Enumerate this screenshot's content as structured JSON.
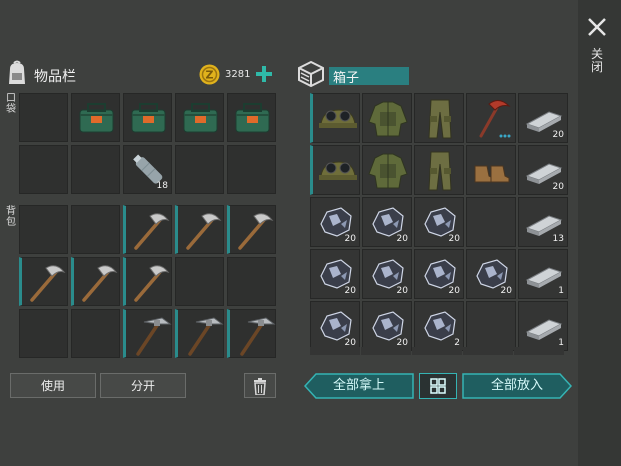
{
  "inventory": {
    "title": "物品栏",
    "coins": "3281",
    "pocket_label": "口袋",
    "backpack_label": "背包",
    "use_label": "使用",
    "split_label": "分开"
  },
  "box": {
    "title": "箱子",
    "take_all_label": "全部拿上",
    "put_all_label": "全部放入"
  },
  "close_label": "关闭",
  "pocket_slots": [
    {
      "item": "",
      "count": ""
    },
    {
      "item": "toolbox-icon",
      "count": ""
    },
    {
      "item": "toolbox-icon",
      "count": ""
    },
    {
      "item": "toolbox-icon",
      "count": ""
    },
    {
      "item": "toolbox-icon",
      "count": ""
    },
    {
      "item": "",
      "count": ""
    },
    {
      "item": "",
      "count": ""
    },
    {
      "item": "water-bottle-icon",
      "count": "18"
    },
    {
      "item": "",
      "count": ""
    },
    {
      "item": "",
      "count": ""
    }
  ],
  "backpack_slots": [
    {
      "item": "",
      "count": ""
    },
    {
      "item": "",
      "count": ""
    },
    {
      "item": "stone-pickaxe-icon",
      "count": ""
    },
    {
      "item": "stone-pickaxe-icon",
      "count": ""
    },
    {
      "item": "stone-pickaxe-icon",
      "count": ""
    },
    {
      "item": "stone-pickaxe-icon",
      "count": ""
    },
    {
      "item": "stone-pickaxe-icon",
      "count": ""
    },
    {
      "item": "stone-pickaxe-icon",
      "count": ""
    },
    {
      "item": "",
      "count": ""
    },
    {
      "item": "",
      "count": ""
    },
    {
      "item": "",
      "count": ""
    },
    {
      "item": "",
      "count": ""
    },
    {
      "item": "iron-pickaxe-icon",
      "count": ""
    },
    {
      "item": "iron-pickaxe-icon",
      "count": ""
    },
    {
      "item": "iron-pickaxe-icon",
      "count": ""
    }
  ],
  "box_slots": [
    {
      "item": "cap-goggles-icon",
      "count": ""
    },
    {
      "item": "military-jacket-icon",
      "count": ""
    },
    {
      "item": "military-pants-icon",
      "count": ""
    },
    {
      "item": "red-pickaxe-icon",
      "count": ""
    },
    {
      "item": "iron-bar-icon",
      "count": "20"
    },
    {
      "item": "cap-goggles-icon",
      "count": ""
    },
    {
      "item": "military-jacket-icon",
      "count": ""
    },
    {
      "item": "military-pants-icon",
      "count": ""
    },
    {
      "item": "boots-icon",
      "count": ""
    },
    {
      "item": "iron-bar-icon",
      "count": "20"
    },
    {
      "item": "iron-ore-icon",
      "count": "20"
    },
    {
      "item": "iron-ore-icon",
      "count": "20"
    },
    {
      "item": "iron-ore-icon",
      "count": "20"
    },
    {
      "item": "",
      "count": ""
    },
    {
      "item": "iron-bar-icon",
      "count": "13"
    },
    {
      "item": "iron-ore-icon",
      "count": "20"
    },
    {
      "item": "iron-ore-icon",
      "count": "20"
    },
    {
      "item": "iron-ore-icon",
      "count": "20"
    },
    {
      "item": "iron-ore-icon",
      "count": "20"
    },
    {
      "item": "iron-bar-icon",
      "count": "1"
    },
    {
      "item": "iron-ore-icon",
      "count": "20"
    },
    {
      "item": "iron-ore-icon",
      "count": "20"
    },
    {
      "item": "iron-ore-icon",
      "count": "2"
    },
    {
      "item": "",
      "count": ""
    },
    {
      "item": "iron-bar-icon",
      "count": "1"
    }
  ],
  "colors": {
    "accent": "#2a9c9c",
    "background": "#3e403e",
    "slot": "#2f302f",
    "coin": "#e0b21c"
  }
}
